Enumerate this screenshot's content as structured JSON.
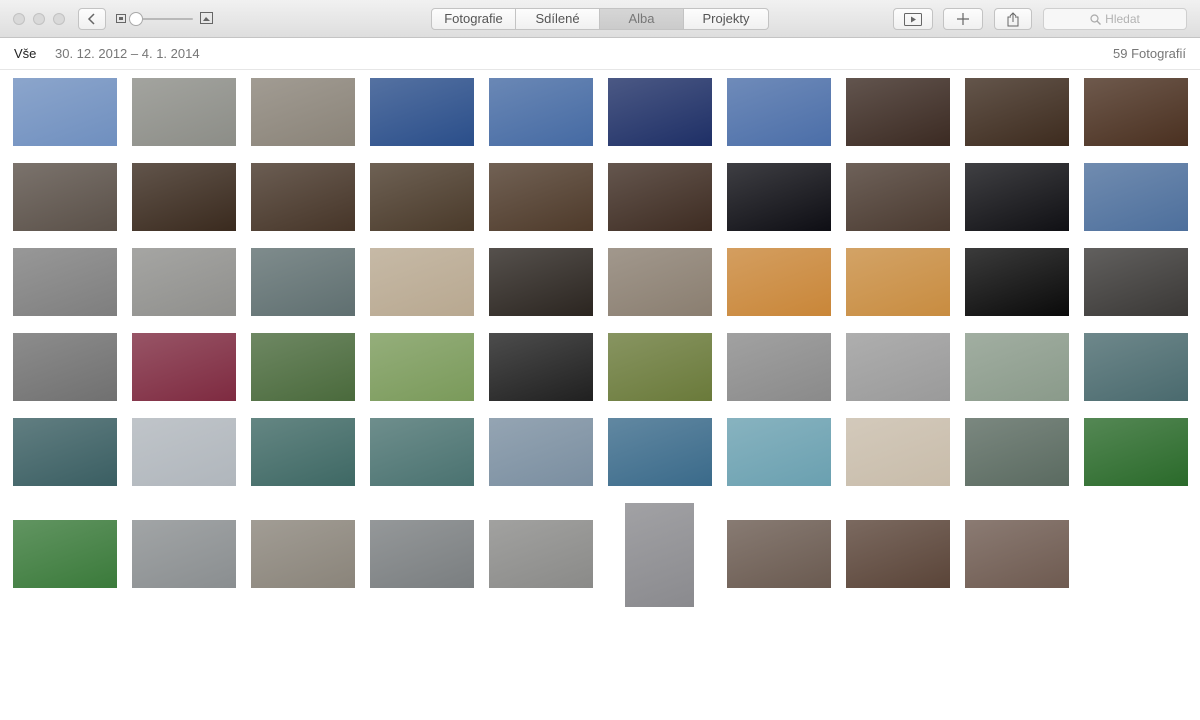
{
  "toolbar": {
    "tabs": [
      "Fotografie",
      "Sdílené",
      "Alba",
      "Projekty"
    ],
    "active_tab": 2,
    "search_placeholder": "Hledat",
    "icons": [
      "back-icon",
      "zoom-small-icon",
      "zoom-large-icon",
      "slideshow-icon",
      "add-icon",
      "share-icon",
      "search-icon"
    ]
  },
  "subbar": {
    "label": "Vše",
    "date_range": "30. 12. 2012 – 4. 1. 2014",
    "count": "59 Fotografií"
  },
  "colors": {
    "titlebar": "#e8e8e8",
    "photos": [
      [
        "#6f8fbf",
        "#8c8d87",
        "#8a8378",
        "#2a4e8a",
        "#456aa3",
        "#1e2f66",
        "#4b6ea8",
        "#3b2a22",
        "#3d2b1e",
        "#4a3020"
      ],
      [
        "#5a5048",
        "#3a2a1e",
        "#463528",
        "#4a3a2a",
        "#4e3a2a",
        "#3e2c22",
        "#0e0e14",
        "#4a3a30",
        "#101014",
        "#4d6f9c"
      ],
      [
        "#7e7e7e",
        "#8f8f8c",
        "#5f6f70",
        "#b8a890",
        "#2b2520",
        "#8a7e70",
        "#c98638",
        "#c88c40",
        "#0a0a0a",
        "#3a3836"
      ],
      [
        "#707070",
        "#7e2a40",
        "#4a6a3c",
        "#7a9a5a",
        "#202020",
        "#6a7a3a",
        "#8a8a8a",
        "#9a9a9a",
        "#8a9a8a",
        "#4a6a6e"
      ],
      [
        "#3a5e62",
        "#b0b6bc",
        "#3e6864",
        "#4a7270",
        "#7a8ea0",
        "#3a6a8a",
        "#6aa0b0",
        "#c8bcaa",
        "#5a6a60",
        "#2a6a2a"
      ],
      [
        "#3a7a3a",
        "#8a8e90",
        "#8a847a",
        "#7a7e80",
        "#8a8a88",
        "#8a8a8e",
        "#6a5a50",
        "#5a4438",
        "#6e5a50"
      ]
    ]
  }
}
